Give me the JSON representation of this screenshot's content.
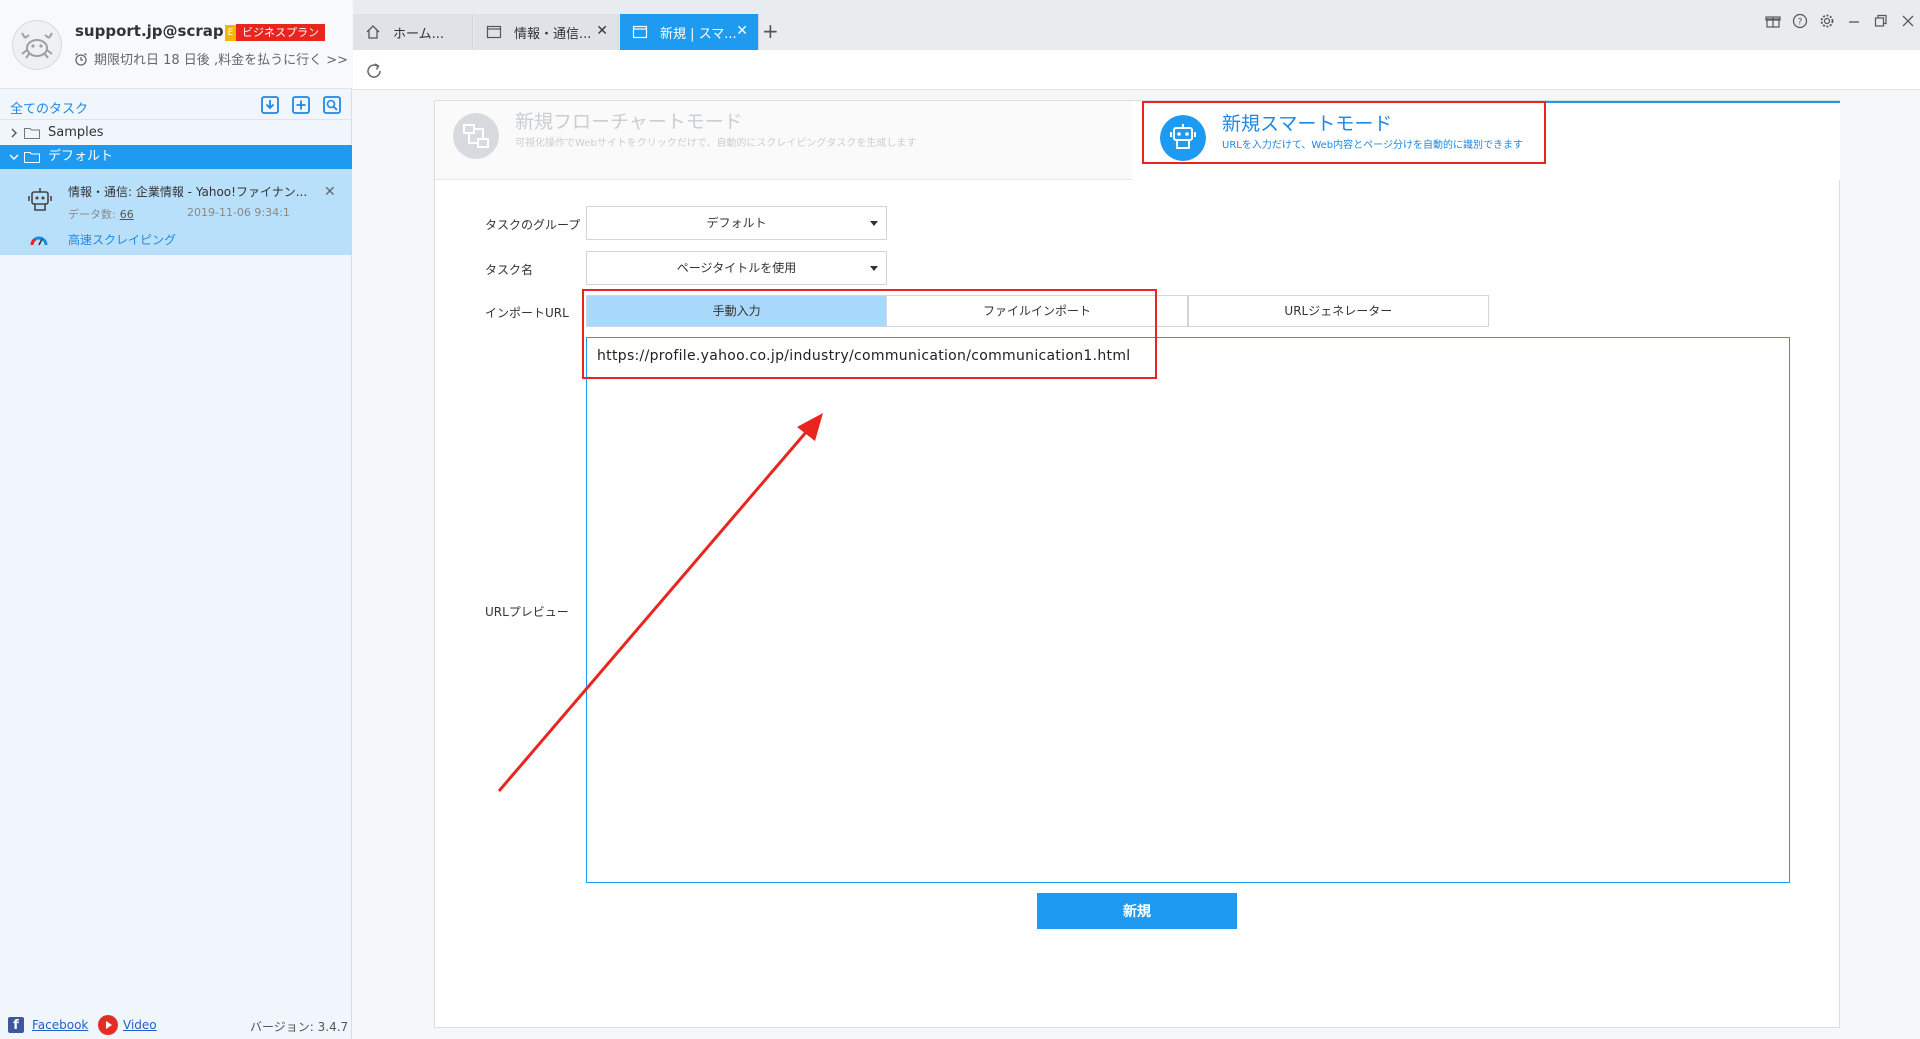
{
  "profile": {
    "email": "support.jp@scrap...",
    "edition_badge": "E",
    "plan": "ビジネスプラン",
    "expiry": "期限切れ日 18 日後 ,料金を払うに行く >>"
  },
  "sidebar": {
    "all_tasks": "全てのタスク",
    "folders": [
      {
        "label": "Samples"
      },
      {
        "label": "デフォルト"
      }
    ],
    "task": {
      "title": "情報・通信: 企業情報 - Yahoo!ファイナン...",
      "count_label": "データ数:",
      "count": "66",
      "date": "2019-11-06 9:34:1",
      "mode": "高速スクレイピング"
    },
    "footer": {
      "facebook": "Facebook",
      "video": "Video",
      "version": "バージョン: 3.4.7"
    }
  },
  "tabs": [
    {
      "label": "ホーム...",
      "icon": "home-icon"
    },
    {
      "label": "情報・通信...",
      "icon": "page-icon"
    },
    {
      "label": "新規 | スマ...",
      "icon": "page-icon"
    }
  ],
  "modes": {
    "flow": {
      "title": "新規フローチャートモード",
      "desc": "可視化操作でWebサイトをクリックだけで、自動的にスクレイピングタスクを生成します"
    },
    "smart": {
      "title": "新規スマートモード",
      "desc": "URLを入力だけて、Web内容とページ分けを自動的に識別できます"
    }
  },
  "form": {
    "group_label": "タスクのグループ",
    "group_value": "デフォルト",
    "name_label": "タスク名",
    "name_value": "ページタイトルを使用",
    "import_label": "インポートURL",
    "import_tabs": [
      "手動入力",
      "ファイルインポート",
      "",
      "URLジェネレーター"
    ],
    "preview_label": "URLプレビュー",
    "url_value": "https://profile.yahoo.co.jp/industry/communication/communication1.html",
    "submit": "新規"
  },
  "colors": {
    "accent": "#1e9bf0",
    "annotation": "#e8261f",
    "selected_item": "#b9e0fb"
  }
}
